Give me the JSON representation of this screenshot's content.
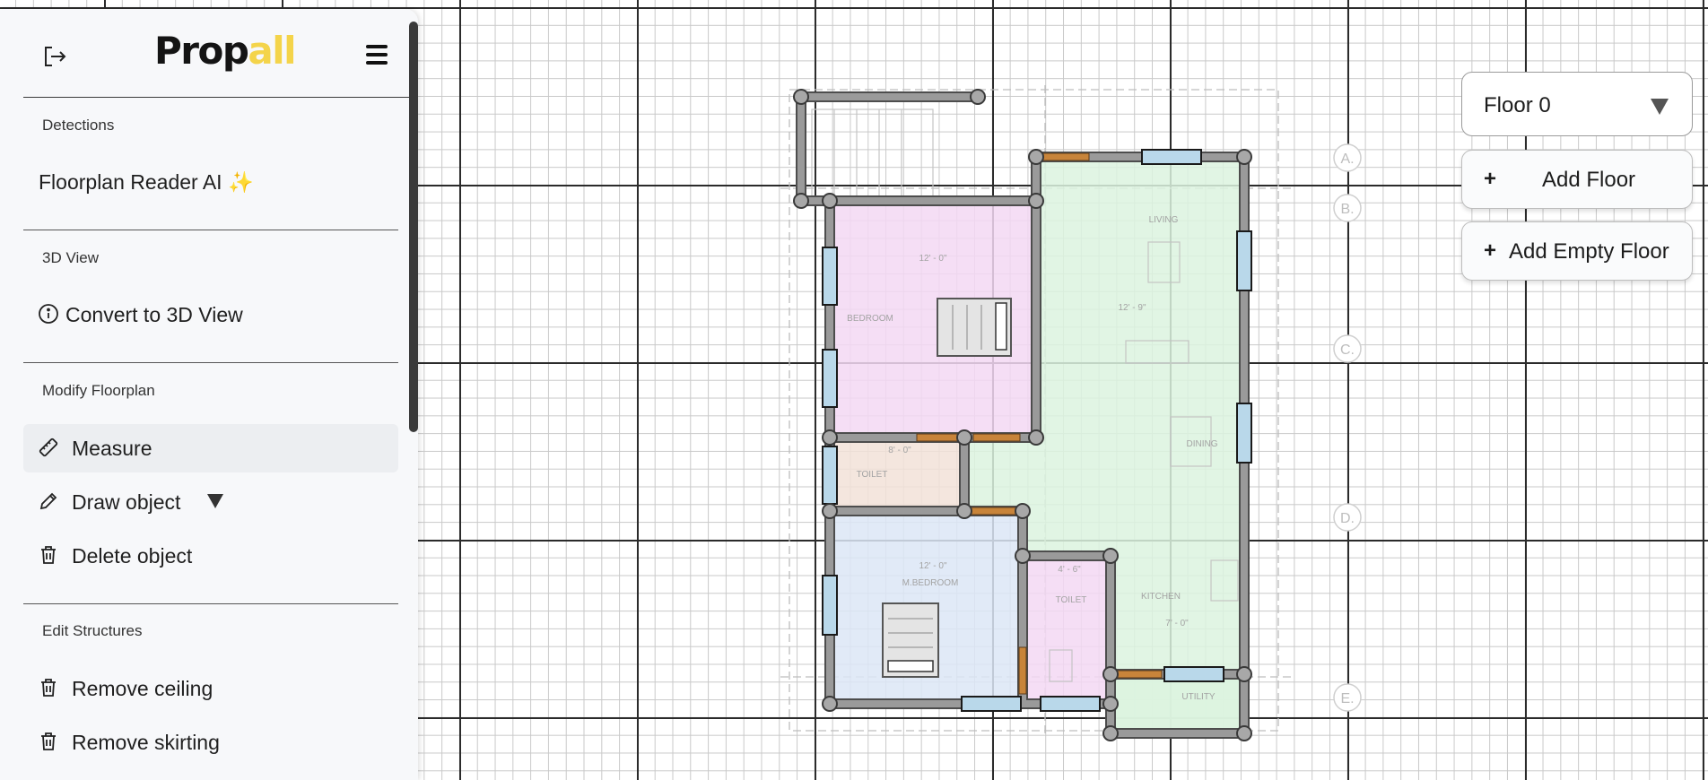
{
  "app": {
    "logo_part1": "Prop",
    "logo_part2": "all",
    "brand_color": "#f4d44a"
  },
  "sidebar": {
    "sections": [
      {
        "title": "Detections",
        "items": [
          {
            "label": "Floorplan Reader AI ✨",
            "icon": "none"
          }
        ]
      },
      {
        "title": "3D View",
        "items": [
          {
            "label": "Convert to 3D View",
            "icon": "info-icon"
          }
        ]
      },
      {
        "title": "Modify Floorplan",
        "items": [
          {
            "label": "Measure",
            "icon": "ruler-icon"
          },
          {
            "label": "Draw object",
            "icon": "pencil-icon"
          },
          {
            "label": "Delete object",
            "icon": "trash-icon"
          }
        ]
      },
      {
        "title": "Edit Structures",
        "items": [
          {
            "label": "Remove ceiling",
            "icon": "trash-icon"
          },
          {
            "label": "Remove skirting",
            "icon": "trash-icon"
          }
        ]
      }
    ]
  },
  "floors": {
    "selected": "Floor 0",
    "add_floor_label": "Add Floor",
    "add_empty_floor_label": "Add Empty Floor",
    "plus": "+"
  },
  "floorplan": {
    "grid_labels": [
      "A.",
      "B.",
      "C.",
      "D.",
      "E."
    ],
    "rooms": {
      "bedroom": "BEDROOM",
      "living": "LIVING",
      "toilet1": "TOILET",
      "toilet2": "TOILET",
      "m_bedroom": "M.BEDROOM",
      "dining": "DINING",
      "kitchen": "KITCHEN",
      "utility": "UTILITY"
    },
    "dims": {
      "d1": "12' - 0\"",
      "d2": "12' - 9\"",
      "d3": "12' - 0\"",
      "d4": "8' - 0\"",
      "d5": "4' - 6\"",
      "d6": "7' - 0\""
    },
    "colors": {
      "wall": "#9a9a9a",
      "node": "#a8a8a8",
      "window": "#b9d8ea",
      "door": "#c8843a",
      "bedroom_fill": "#f3d8f3",
      "living_fill": "#dcf3df",
      "toilet_fill": "#f2e2d8",
      "mbedroom_fill": "#dce6f6"
    }
  }
}
